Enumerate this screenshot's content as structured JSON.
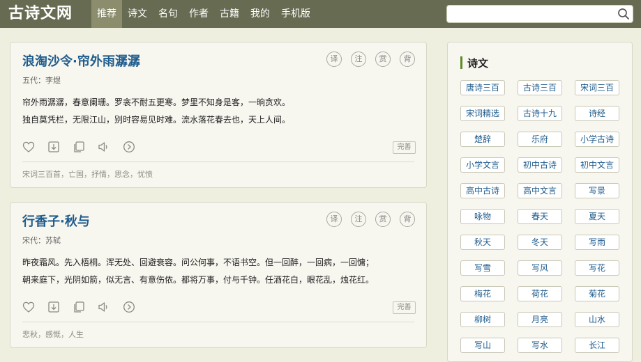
{
  "header": {
    "logo": "古诗文网",
    "nav": [
      "推荐",
      "诗文",
      "名句",
      "作者",
      "古籍",
      "我的",
      "手机版"
    ],
    "search_placeholder": ""
  },
  "poems": [
    {
      "title": "浪淘沙令·帘外雨潺潺",
      "author": "五代：李煜",
      "lines": [
        "帘外雨潺潺，春意阑珊。罗衾不耐五更寒。梦里不知身是客，一晌贪欢。",
        "独自莫凭栏，无限江山，别时容易见时难。流水落花春去也，天上人间。"
      ],
      "circle_buttons": [
        "译",
        "注",
        "赏",
        "背"
      ],
      "perfect_label": "完善",
      "tags": "宋词三百首，亡国，抒情，思念，忧愤"
    },
    {
      "title": "行香子·秋与",
      "author": "宋代：苏轼",
      "lines": [
        "昨夜霜风。先入梧桐。浑无处、回避衰容。问公何事，不语书空。但一回醉，一回病，一回慵；",
        "朝来庭下，光阴如箭，似无言、有意伤侬。都将万事，付与千钟。任酒花白，眼花乱，烛花红。"
      ],
      "circle_buttons": [
        "译",
        "注",
        "赏",
        "背"
      ],
      "perfect_label": "完善",
      "tags": "悲秋，感慨，人生"
    }
  ],
  "sidebar": {
    "title": "诗文",
    "tags": [
      "唐诗三百",
      "古诗三百",
      "宋词三百",
      "宋词精选",
      "古诗十九",
      "诗经",
      "楚辞",
      "乐府",
      "小学古诗",
      "小学文言",
      "初中古诗",
      "初中文言",
      "高中古诗",
      "高中文言",
      "写景",
      "咏物",
      "春天",
      "夏天",
      "秋天",
      "冬天",
      "写雨",
      "写雪",
      "写风",
      "写花",
      "梅花",
      "荷花",
      "菊花",
      "柳树",
      "月亮",
      "山水",
      "写山",
      "写水",
      "长江"
    ]
  },
  "colors": {
    "header_bg": "#676b52",
    "nav_active": "#8b8d6d",
    "title_blue": "#1e5b8c",
    "page_bg": "#efefe0"
  }
}
